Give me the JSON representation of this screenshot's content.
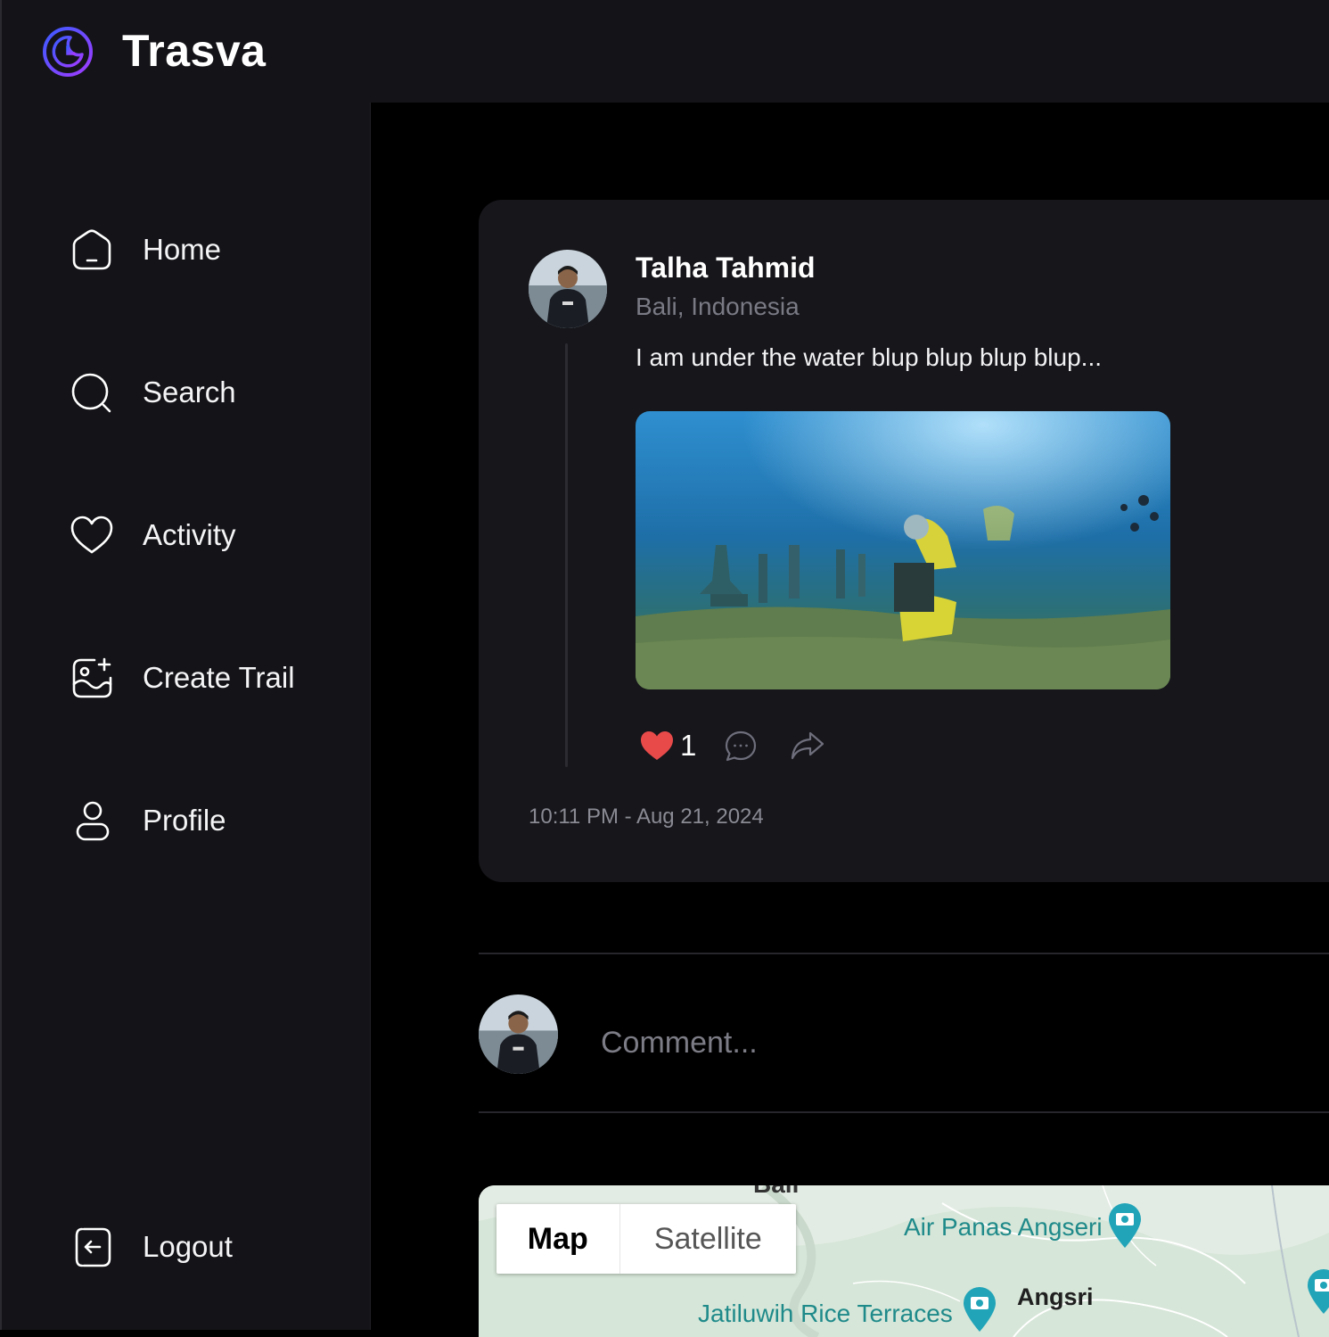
{
  "app": {
    "brand": "Trasva",
    "logo_icon": "moon-clock-logo-icon",
    "accent_gradient": [
      "#3b5bff",
      "#a23bff"
    ]
  },
  "sidebar": {
    "items": [
      {
        "label": "Home",
        "icon": "home-icon"
      },
      {
        "label": "Search",
        "icon": "search-icon"
      },
      {
        "label": "Activity",
        "icon": "heart-icon"
      },
      {
        "label": "Create Trail",
        "icon": "image-add-icon"
      },
      {
        "label": "Profile",
        "icon": "user-icon"
      }
    ],
    "logout": {
      "label": "Logout",
      "icon": "logout-icon"
    }
  },
  "post": {
    "author": "Talha Tahmid",
    "location": "Bali, Indonesia",
    "text": "I am under the water blup blup blup blup...",
    "likes": "1",
    "timestamp": "10:11 PM - Aug 21, 2024",
    "like_color": "#e84a4a"
  },
  "comment": {
    "placeholder": "Comment..."
  },
  "map": {
    "toggle": {
      "map": "Map",
      "satellite": "Satellite"
    },
    "places": [
      {
        "name": "Air Panas Angseri"
      },
      {
        "name": "Jatiluwih Rice Terraces"
      },
      {
        "name": "Angsri"
      }
    ],
    "top_label": "Bali"
  },
  "colors": {
    "background": "#000000",
    "panel": "#141418",
    "card": "#16161b",
    "muted_text": "#7a7a85",
    "map_place_text": "#1f8a8a"
  }
}
